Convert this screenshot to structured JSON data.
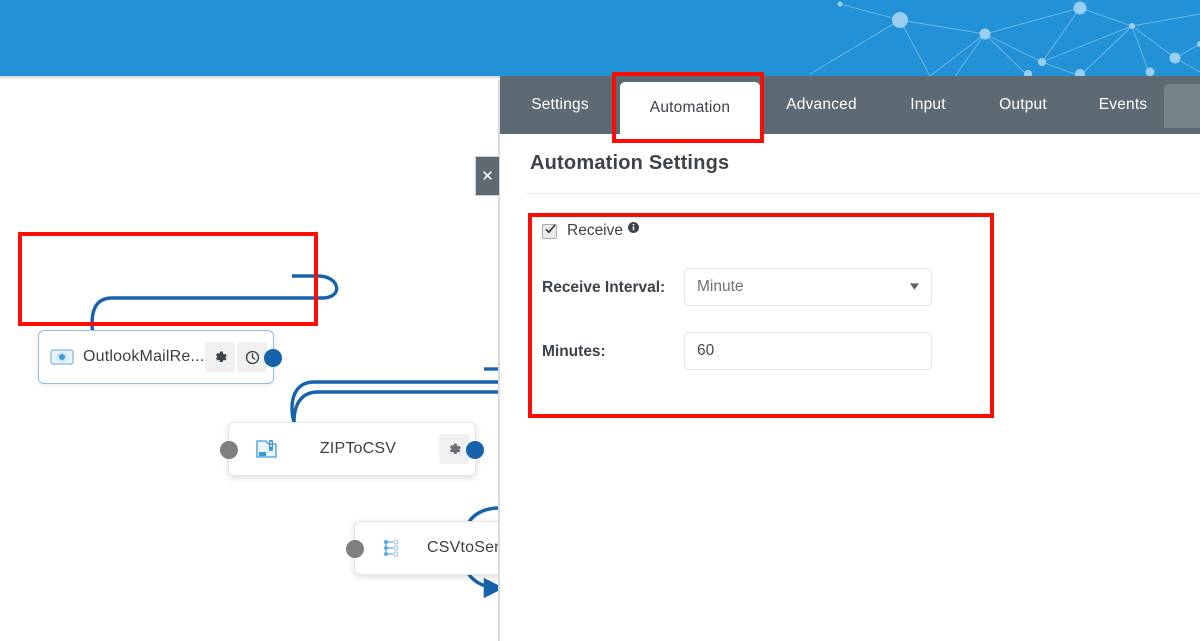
{
  "header": {
    "brand_color": "#2391d5",
    "graphic": "network-constellation"
  },
  "canvas": {
    "nodes": [
      {
        "id": "outlook",
        "title": "OutlookMailRe...",
        "icon": "outlook-mail-icon",
        "selected": true,
        "buttons": [
          "gear-icon",
          "clock-icon"
        ],
        "has_input_port": false,
        "has_output_port": true
      },
      {
        "id": "zip",
        "title": "ZIPToCSV",
        "icon": "zip-file-icon",
        "selected": false,
        "buttons": [
          "gear-icon"
        ],
        "has_input_port": true,
        "has_output_port": true
      },
      {
        "id": "csv",
        "title": "CSVtoSendG",
        "icon": "flow-branch-icon",
        "selected": false,
        "buttons": [],
        "has_input_port": true,
        "has_output_port": false
      }
    ],
    "edge_color": "#1763ab",
    "close_button_label": "✕"
  },
  "panel": {
    "tabs": [
      {
        "label": "Settings",
        "active": false
      },
      {
        "label": "Automation",
        "active": true
      },
      {
        "label": "Advanced",
        "active": false
      },
      {
        "label": "Input",
        "active": false
      },
      {
        "label": "Output",
        "active": false
      },
      {
        "label": "Events",
        "active": false
      }
    ],
    "title": "Automation Settings",
    "receive": {
      "label": "Receive",
      "checked": true,
      "info_icon": "info-icon"
    },
    "fields": [
      {
        "label": "Receive Interval:",
        "type": "select",
        "value": "Minute"
      },
      {
        "label": "Minutes:",
        "type": "text",
        "value": "60"
      }
    ]
  },
  "annotations": {
    "color": "#fb0d05",
    "boxes": [
      "selected-node",
      "automation-tab",
      "automation-form"
    ]
  }
}
